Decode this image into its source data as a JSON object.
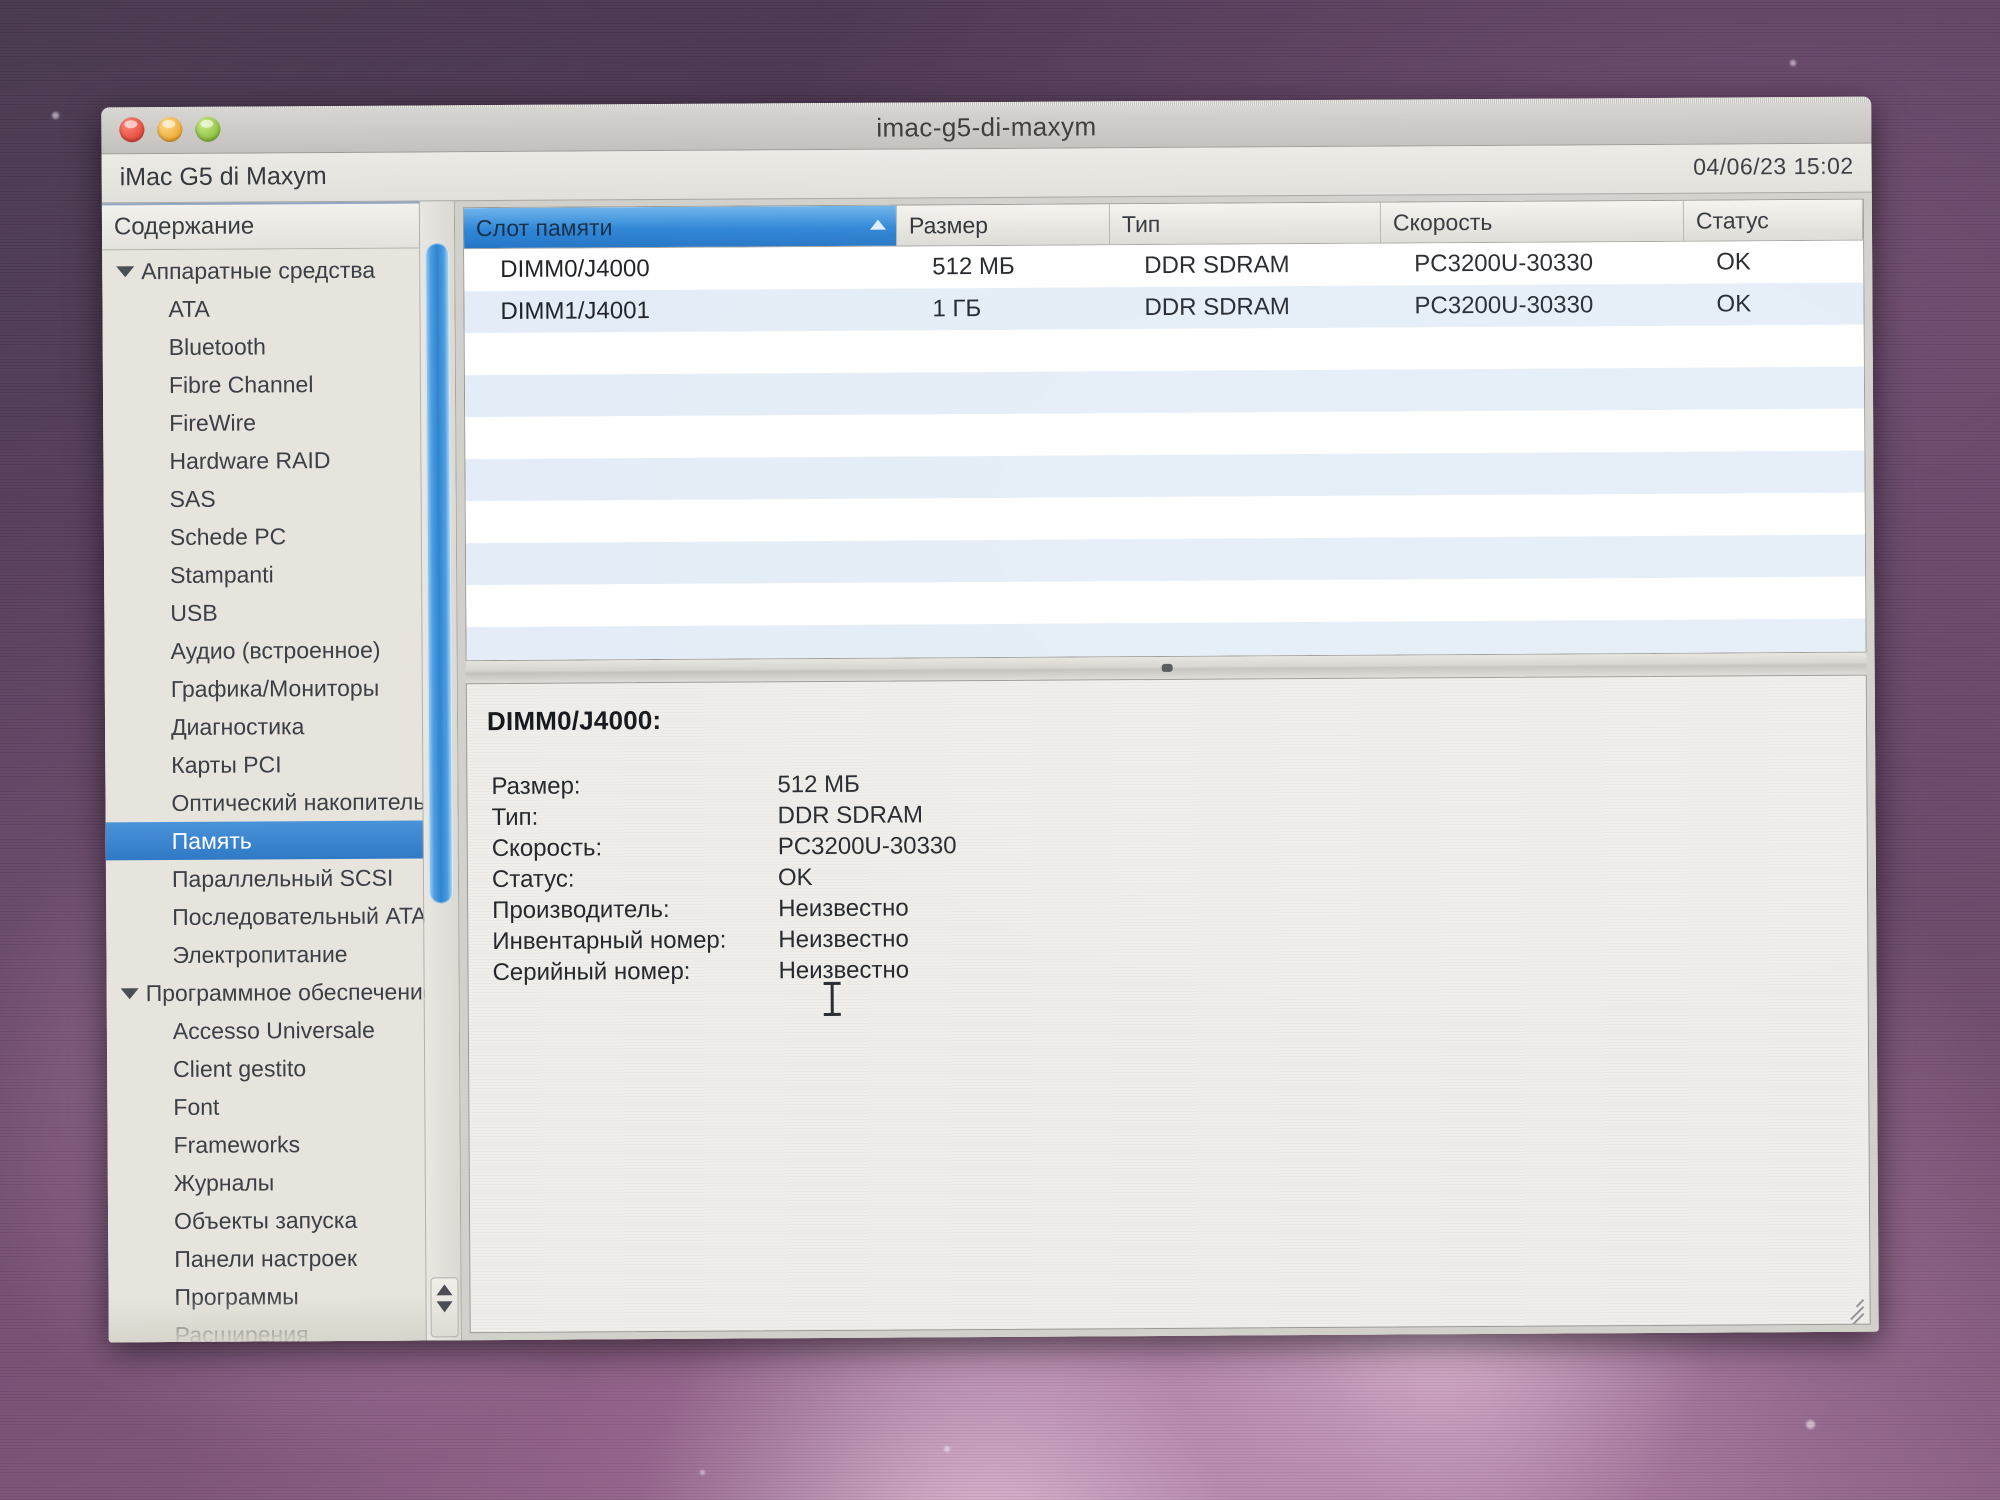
{
  "window": {
    "title": "imac-g5-di-maxym",
    "traffic_lights": [
      "close-button",
      "minimize-button",
      "zoom-button"
    ]
  },
  "subbar": {
    "device_name": "iMac G5 di Maxym",
    "datetime": "04/06/23 15:02"
  },
  "sidebar": {
    "header": "Содержание",
    "selected": "Память",
    "items": [
      {
        "label": "Аппаратные средства",
        "type": "group"
      },
      {
        "label": "ATA",
        "type": "child"
      },
      {
        "label": "Bluetooth",
        "type": "child"
      },
      {
        "label": "Fibre Channel",
        "type": "child"
      },
      {
        "label": "FireWire",
        "type": "child"
      },
      {
        "label": "Hardware RAID",
        "type": "child"
      },
      {
        "label": "SAS",
        "type": "child"
      },
      {
        "label": "Schede PC",
        "type": "child"
      },
      {
        "label": "Stampanti",
        "type": "child"
      },
      {
        "label": "USB",
        "type": "child"
      },
      {
        "label": "Аудио (встроенное)",
        "type": "child"
      },
      {
        "label": "Графика/Мониторы",
        "type": "child"
      },
      {
        "label": "Диагностика",
        "type": "child"
      },
      {
        "label": "Карты PCI",
        "type": "child"
      },
      {
        "label": "Оптический накопитель",
        "type": "child"
      },
      {
        "label": "Память",
        "type": "child"
      },
      {
        "label": "Параллельный SCSI",
        "type": "child"
      },
      {
        "label": "Последовательный ATA",
        "type": "child"
      },
      {
        "label": "Электропитание",
        "type": "child"
      },
      {
        "label": "Программное обеспечение",
        "type": "group"
      },
      {
        "label": "Accesso Universale",
        "type": "child"
      },
      {
        "label": "Client gestito",
        "type": "child"
      },
      {
        "label": "Font",
        "type": "child"
      },
      {
        "label": "Frameworks",
        "type": "child"
      },
      {
        "label": "Журналы",
        "type": "child"
      },
      {
        "label": "Объекты запуска",
        "type": "child"
      },
      {
        "label": "Панели настроек",
        "type": "child"
      },
      {
        "label": "Программы",
        "type": "child"
      },
      {
        "label": "Расширения",
        "type": "child"
      }
    ]
  },
  "table": {
    "sorted_column": "Слот памяти",
    "sort_direction": "ascending",
    "columns": [
      "Слот памяти",
      "Размер",
      "Тип",
      "Скорость",
      "Статус"
    ],
    "rows": [
      [
        "DIMM0/J4000",
        "512 МБ",
        "DDR SDRAM",
        "PC3200U-30330",
        "OK"
      ],
      [
        "DIMM1/J4001",
        "1 ГБ",
        "DDR SDRAM",
        "PC3200U-30330",
        "OK"
      ]
    ]
  },
  "detail": {
    "title": "DIMM0/J4000:",
    "fields": [
      {
        "key": "Размер:",
        "value": "512 МБ"
      },
      {
        "key": "Тип:",
        "value": "DDR SDRAM"
      },
      {
        "key": "Скорость:",
        "value": "PC3200U-30330"
      },
      {
        "key": "Статус:",
        "value": "OK"
      },
      {
        "key": "Производитель:",
        "value": "Неизвестно"
      },
      {
        "key": "Инвентарный номер:",
        "value": "Неизвестно"
      },
      {
        "key": "Серийный номер:",
        "value": "Неизвестно"
      }
    ]
  },
  "colors": {
    "selection_blue": "#2f79c6",
    "sorted_header_blue": "#2f86d6",
    "row_stripe": "#e4edf7",
    "window_chrome": "#d4d2cd"
  }
}
